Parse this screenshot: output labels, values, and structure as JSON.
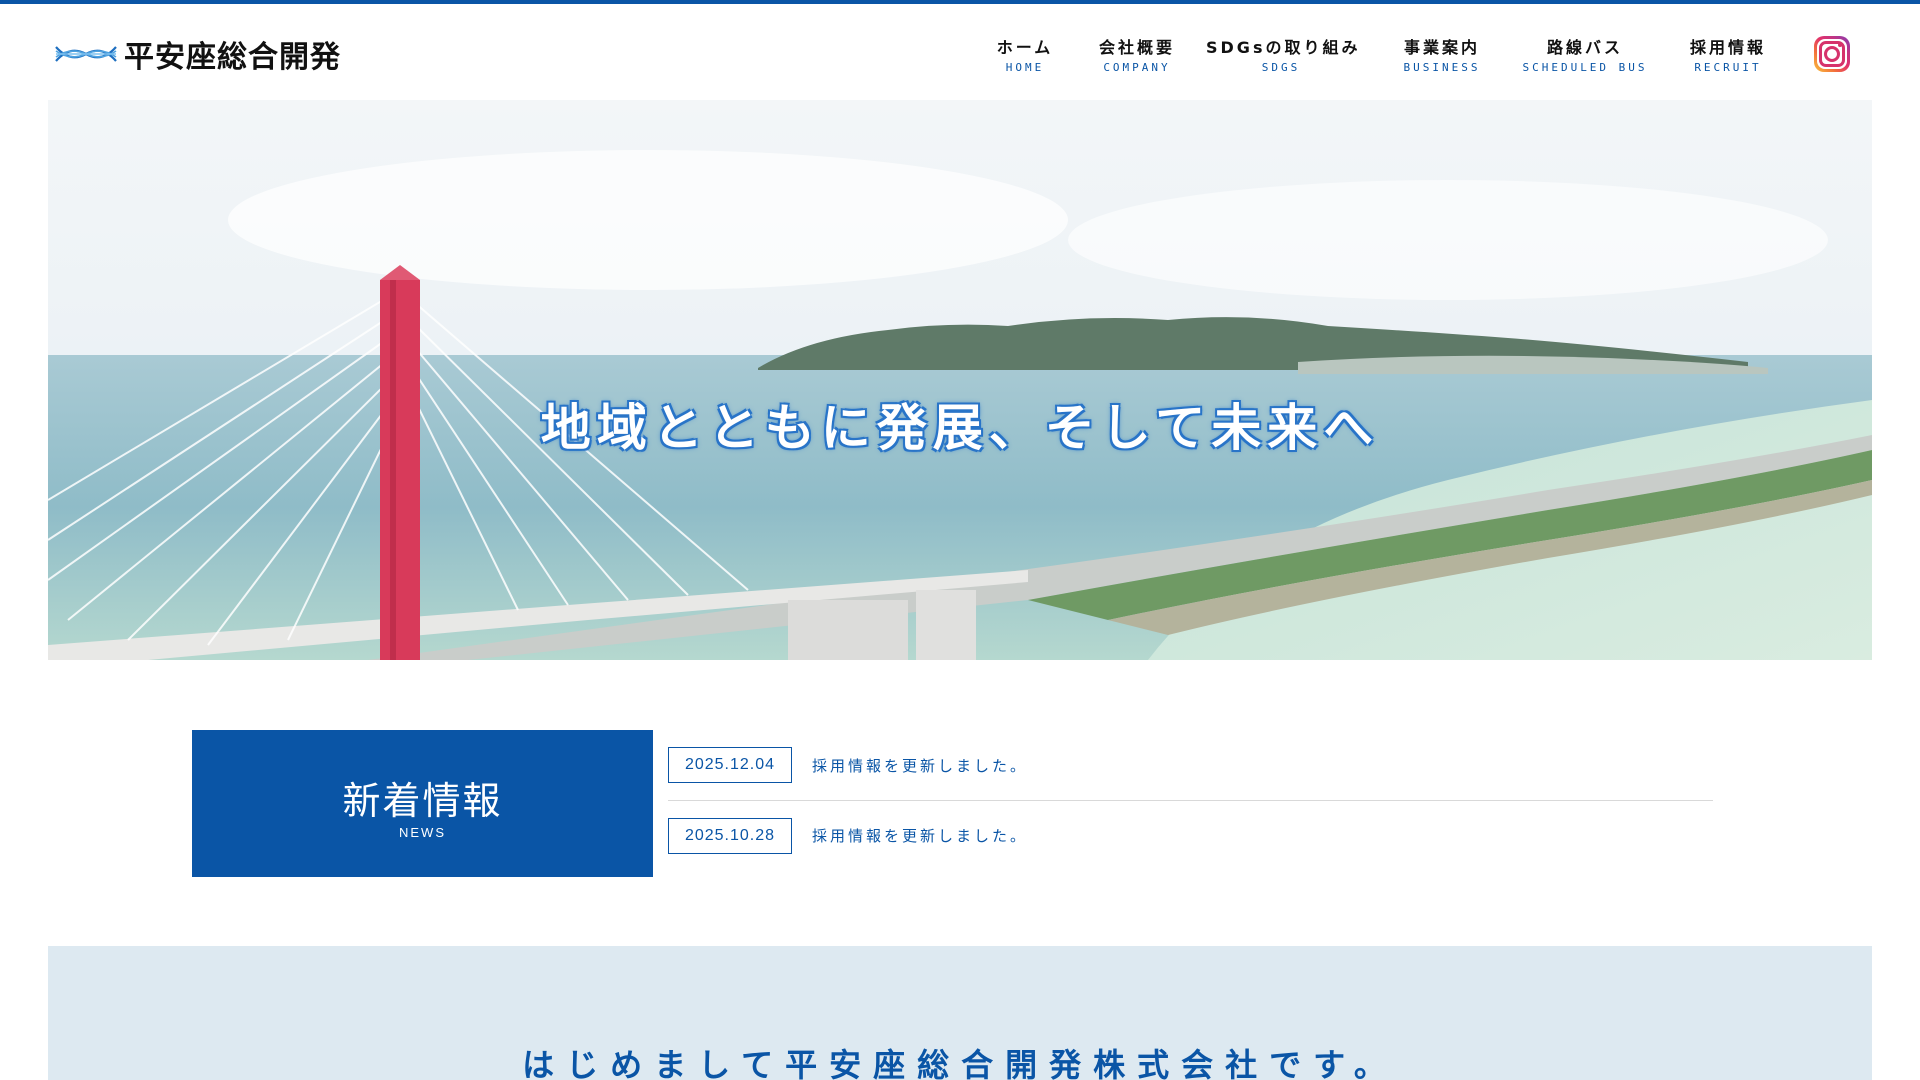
{
  "header": {
    "logo_text": "平安座総合開発",
    "nav": [
      {
        "label": "ホーム",
        "sub": "HOME"
      },
      {
        "label": "会社概要",
        "sub": "COMPANY"
      },
      {
        "label": "SDGsの取り組み",
        "sub": "SDGS"
      },
      {
        "label": "事業案内",
        "sub": "BUSINESS"
      },
      {
        "label": "路線バス",
        "sub": "SCHEDULED BUS"
      },
      {
        "label": "採用情報",
        "sub": "RECRUIT"
      }
    ],
    "instagram_icon": "instagram-icon"
  },
  "hero": {
    "catch": "地域とともに発展、そして未来へ"
  },
  "news": {
    "title": "新着情報",
    "subtitle": "NEWS",
    "items": [
      {
        "date": "2025.12.04",
        "text": "採用情報を更新しました。"
      },
      {
        "date": "2025.10.28",
        "text": "採用情報を更新しました。"
      }
    ]
  },
  "intro": {
    "title": "はじめまして平安座総合開発株式会社です。"
  },
  "colors": {
    "brand_blue": "#0a55a6",
    "intro_bg": "#dde9f1",
    "bridge_tower": "#d83a5a"
  }
}
